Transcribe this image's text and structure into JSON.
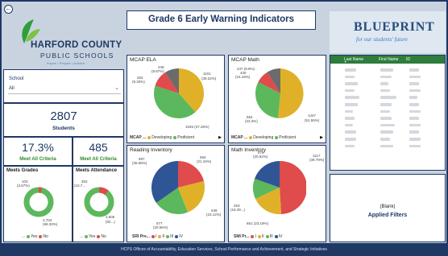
{
  "header": {
    "title": "Grade 6 Early Warning Indicators"
  },
  "logo": {
    "county": "HARFORD COUNTY",
    "schools": "PUBLIC SCHOOLS",
    "tagline": "Inspire • Prepare • Achieve"
  },
  "blueprint": {
    "word": "BLUEPRINT",
    "tagline": "for our students' future"
  },
  "school_filter": {
    "label": "School",
    "value": "All"
  },
  "students": {
    "count": "2807",
    "label": "Students"
  },
  "meet_all_pct": {
    "value": "17.3%",
    "label": "Meet All Criteria"
  },
  "meet_all_count": {
    "value": "485",
    "label": "Meet All Criteria"
  },
  "meets_grades": {
    "title": "Meets Grades",
    "labels": [
      "103",
      "(3.67%)",
      "2,704",
      "(96.33%)"
    ],
    "legend": [
      "...",
      "Yes",
      "No"
    ]
  },
  "meets_attendance": {
    "title": "Meets Attendance",
    "labels": [
      "302",
      "(10.7...",
      "2,505",
      "(82...)"
    ],
    "legend": [
      "...",
      "Yes",
      "No"
    ]
  },
  "mcap_ela": {
    "title": "MCAP ELA",
    "labels": [
      "249",
      "(8.87%)",
      "262",
      "(9.33%)",
      "1101",
      "(39.22%)",
      "1046 (37.26%)"
    ],
    "legend": [
      "MCAP ...",
      "Developing",
      "Proficient"
    ]
  },
  "mcap_math": {
    "title": "MCAP Math",
    "labels": [
      "247 (8.8%)",
      "426",
      "(15.18%)",
      "654",
      "(23.3%)",
      "1447",
      "(51.55%)"
    ],
    "legend": [
      "MCAP ...",
      "Developing",
      "Proficient"
    ]
  },
  "reading": {
    "title": "Reading Inventory",
    "labels": [
      "997",
      "(35.55%)",
      "594",
      "(21.16%)",
      "649",
      "(23.12%)",
      "577",
      "(20.56%)"
    ],
    "legend": [
      "SRI Pre...",
      "I",
      "II",
      "III",
      "IV"
    ]
  },
  "math_inv": {
    "title": "Math Inventory",
    "labels": [
      "576",
      "(20.52%)",
      "1117",
      "(39.79%)",
      "463",
      "(16.49...)",
      "651 (23.19%)"
    ],
    "legend": [
      "SMI Pr...",
      "I",
      "II",
      "III",
      "IV"
    ]
  },
  "table": {
    "columns": [
      "Last Name",
      "First Name",
      "ID"
    ]
  },
  "applied_filters": {
    "blank": "(Blank)",
    "label": "Applied Filters"
  },
  "footer": {
    "text": "HCPS Offices of Accountability, Education Services, School Performance and Achievement, and Strategic Initiatives"
  },
  "colors": {
    "navy": "#1f3864",
    "green": "#5cb85c",
    "red": "#e04b4b",
    "gold": "#e0b128",
    "gray": "#6b6b6b",
    "blue": "#2f5597",
    "table_header": "#2e7d3c"
  }
}
